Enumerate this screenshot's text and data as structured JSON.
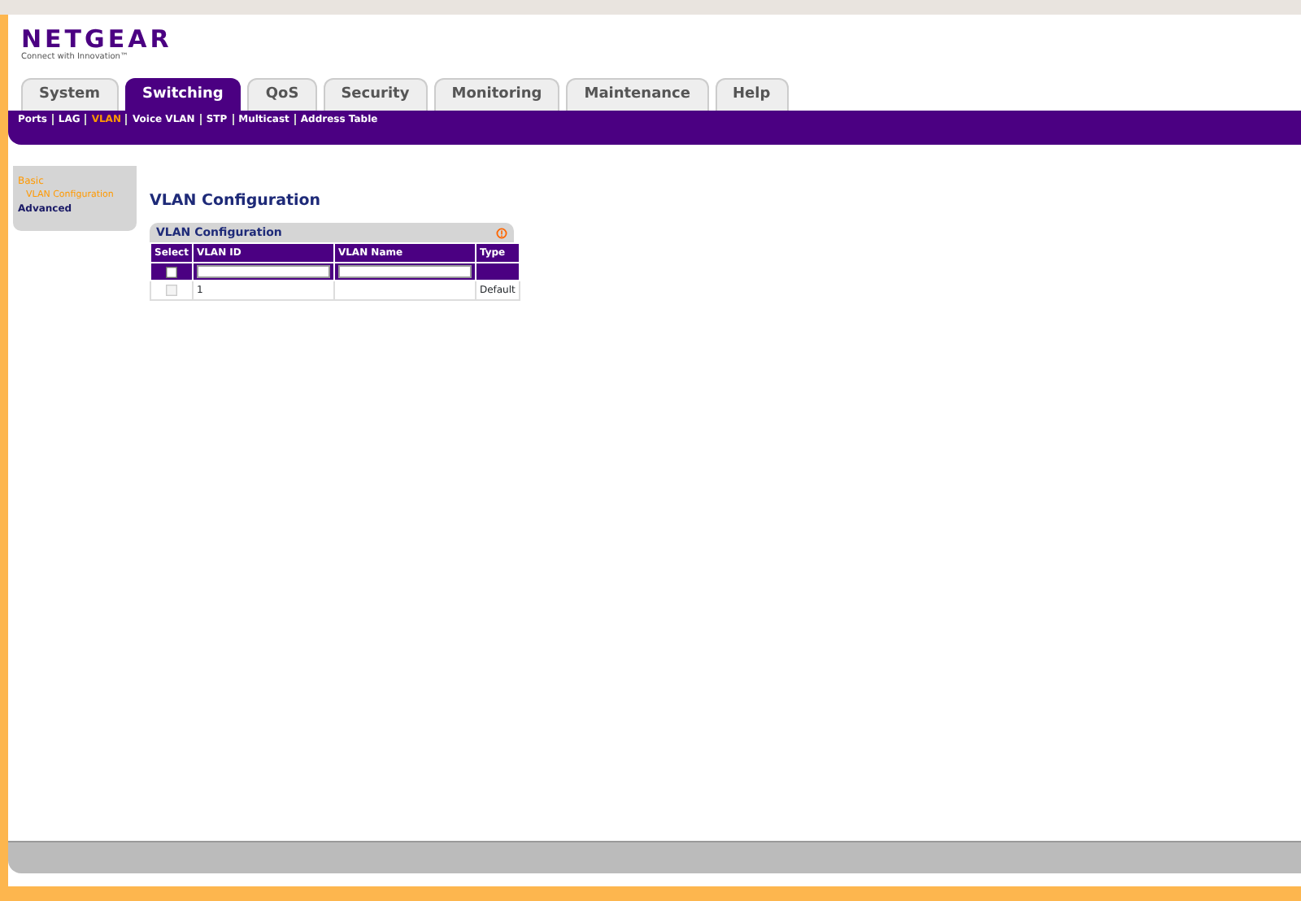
{
  "logo": {
    "name": "NETGEAR",
    "tagline": "Connect with Innovation™"
  },
  "tabs": [
    {
      "label": "System",
      "selected": false
    },
    {
      "label": "Switching",
      "selected": true
    },
    {
      "label": "QoS",
      "selected": false
    },
    {
      "label": "Security",
      "selected": false
    },
    {
      "label": "Monitoring",
      "selected": false
    },
    {
      "label": "Maintenance",
      "selected": false
    },
    {
      "label": "Help",
      "selected": false
    }
  ],
  "subnav": [
    {
      "label": "Ports",
      "selected": false
    },
    {
      "label": "LAG",
      "selected": false
    },
    {
      "label": "VLAN",
      "selected": true
    },
    {
      "label": "Voice VLAN",
      "selected": false
    },
    {
      "label": "STP",
      "selected": false
    },
    {
      "label": "Multicast",
      "selected": false
    },
    {
      "label": "Address Table",
      "selected": false
    }
  ],
  "sidebar": {
    "items": [
      {
        "label": "Basic",
        "selected": true,
        "children": [
          {
            "label": "VLAN Configuration",
            "selected": true
          }
        ]
      },
      {
        "label": "Advanced",
        "selected": false
      }
    ]
  },
  "page_title": "VLAN Configuration",
  "table": {
    "title": "VLAN Configuration",
    "columns": [
      "Select",
      "VLAN ID",
      "VLAN Name",
      "Type"
    ],
    "input_row": {
      "checked": false
    },
    "rows": [
      {
        "checked": false,
        "disabled": true,
        "cells": [
          "",
          "1",
          "",
          "Default"
        ]
      }
    ]
  }
}
